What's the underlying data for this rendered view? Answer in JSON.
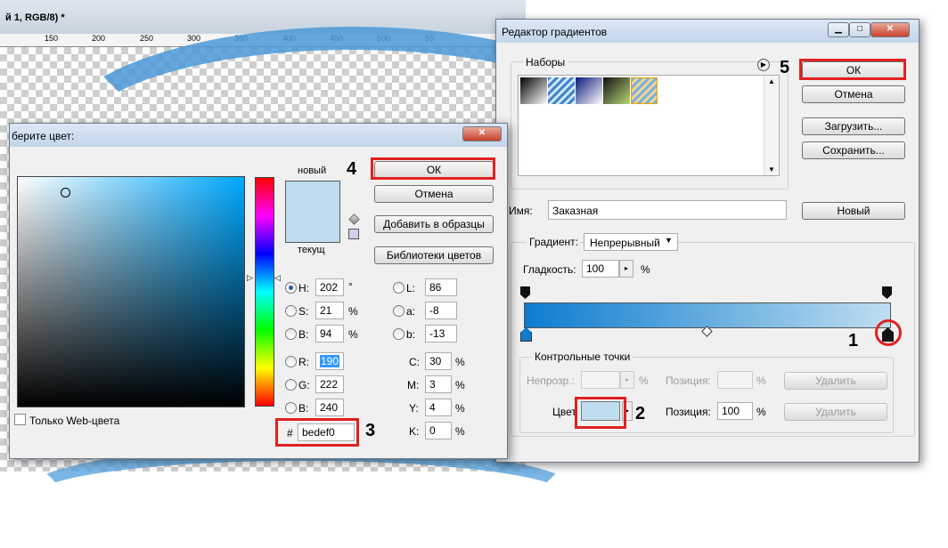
{
  "document": {
    "title": "й 1, RGB/8) *",
    "ruler_ticks": [
      "150",
      "200",
      "250",
      "300",
      "350",
      "400",
      "450",
      "500",
      "55"
    ]
  },
  "gradient_editor": {
    "title": "Редактор градиентов",
    "presets_label": "Наборы",
    "buttons": {
      "ok": "ОК",
      "cancel": "Отмена",
      "load": "Загрузить...",
      "save": "Сохранить...",
      "new": "Новый"
    },
    "name_label": "Имя:",
    "name_value": "Заказная",
    "gradient_type_label": "Градиент:",
    "gradient_type_value": "Непрерывный",
    "smoothness_label": "Гладкость:",
    "smoothness_value": "100",
    "smoothness_unit": "%",
    "stops_group_label": "Контрольные точки",
    "opacity_label": "Непрозр.:",
    "opacity_unit": "%",
    "position_label_1": "Позиция:",
    "position_unit_1": "%",
    "delete_1": "Удалить",
    "color_label": "Цвет",
    "position_label_2": "Позиция:",
    "position_value_2": "100",
    "position_unit_2": "%",
    "delete_2": "Удалить",
    "stop_color": "#bedef0",
    "gradient_start_color": "#0d7ccf",
    "gradient_end_color": "#bedef0"
  },
  "color_picker": {
    "title": "берите цвет:",
    "new_label": "новый",
    "current_label": "текущ",
    "buttons": {
      "ok": "ОК",
      "cancel": "Отмена",
      "add_swatch": "Добавить в образцы",
      "libraries": "Библиотеки цветов"
    },
    "fields": {
      "H": {
        "label": "H:",
        "value": "202",
        "unit": "°"
      },
      "S": {
        "label": "S:",
        "value": "21",
        "unit": "%"
      },
      "B": {
        "label": "B:",
        "value": "94",
        "unit": "%"
      },
      "R": {
        "label": "R:",
        "value": "190"
      },
      "G": {
        "label": "G:",
        "value": "222"
      },
      "Bb": {
        "label": "B:",
        "value": "240"
      },
      "L": {
        "label": "L:",
        "value": "86"
      },
      "a": {
        "label": "a:",
        "value": "-8"
      },
      "b": {
        "label": "b:",
        "value": "-13"
      },
      "C": {
        "label": "C:",
        "value": "30",
        "unit": "%"
      },
      "M": {
        "label": "M:",
        "value": "3",
        "unit": "%"
      },
      "Y": {
        "label": "Y:",
        "value": "4",
        "unit": "%"
      },
      "K": {
        "label": "K:",
        "value": "0",
        "unit": "%"
      }
    },
    "hex_label": "#",
    "hex_value": "bedef0",
    "web_only_label": "Только Web-цвета",
    "new_color": "#bedef0",
    "current_color": "#bedef0"
  },
  "annotations": [
    "1",
    "2",
    "3",
    "4",
    "5"
  ]
}
